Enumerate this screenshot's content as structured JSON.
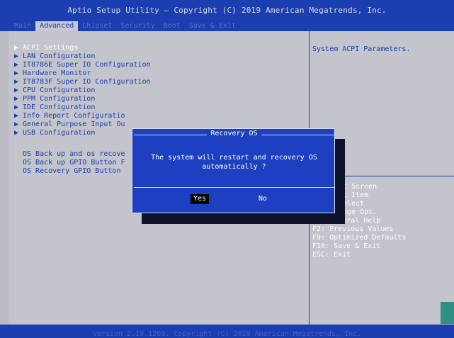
{
  "header": {
    "title": "Aptio Setup Utility – Copyright (C) 2019 American Megatrends, Inc.",
    "tabs": [
      "Main",
      "Advanced",
      "Chipset",
      "Security",
      "Boot",
      "Save & Exit"
    ]
  },
  "menu": {
    "items": [
      "ACPI Settings",
      "LAN Configuration",
      "IT8786E Super IO Configuration",
      "Hardware Monitor",
      "IT8783F Super IO Configuration",
      "CPU Configuration",
      "PPM Configuration",
      "IDE Configuration",
      "Info Report Configuratio",
      "General Purpose Input Ou",
      "USB Configuration",
      "OS Back up and os recove",
      "OS Back up GPIO Button F",
      "OS Recovery GPIO Button"
    ],
    "selected_index": 0
  },
  "help": {
    "description": "System ACPI Parameters.",
    "keys": [
      "ect Screen",
      "ect Item",
      "Select",
      "ange Opt.",
      "F1: General Help",
      "F2: Previous Values",
      "F9: Optimized Defaults",
      "F10: Save & Exit",
      "ESC: Exit"
    ]
  },
  "dialog": {
    "title": "Recovery OS",
    "message_line1": "The system will restart and recovery OS",
    "message_line2": "automatically ?",
    "yes_label": "Yes",
    "no_label": "No"
  },
  "footer": {
    "version": "Version 2.19.1269. Copyright (C) 2019 American Megatrends, Inc."
  },
  "colors": {
    "header_bg": "#1b3fb0",
    "panel_bg": "#c3c4cc",
    "text_blue": "#1b3fb0",
    "dialog_bg": "#1c40c1"
  }
}
